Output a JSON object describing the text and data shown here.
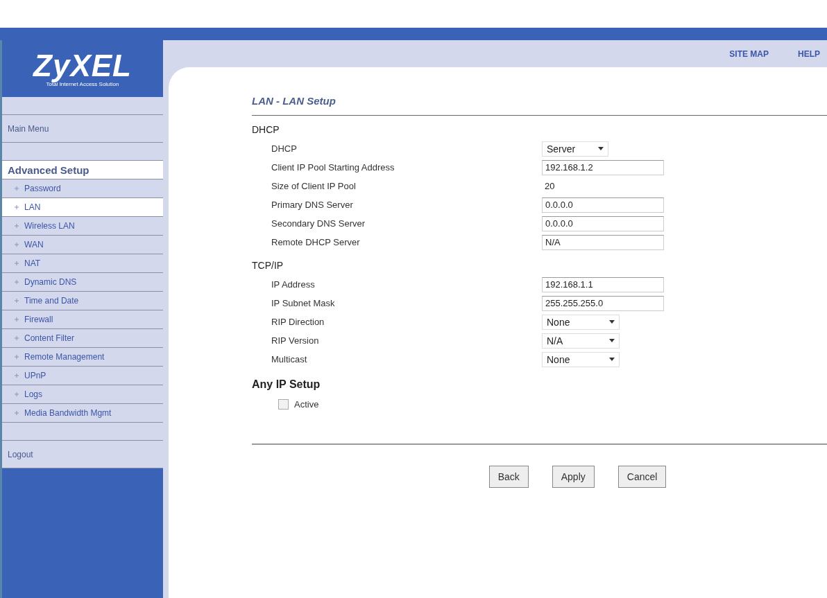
{
  "logo": {
    "brand": "ZyXEL",
    "tagline": "Total Internet Access Solution"
  },
  "header_links": [
    "SITE MAP",
    "HELP"
  ],
  "sidebar": {
    "items": [
      {
        "kind": "spacer"
      },
      {
        "kind": "menu",
        "label": "Main Menu",
        "selected": false
      },
      {
        "kind": "spacer"
      },
      {
        "kind": "section",
        "label": "Advanced Setup"
      },
      {
        "kind": "sub",
        "label": "Password",
        "selected": false
      },
      {
        "kind": "sub",
        "label": "LAN",
        "selected": true
      },
      {
        "kind": "sub",
        "label": "Wireless LAN",
        "selected": false
      },
      {
        "kind": "sub",
        "label": "WAN",
        "selected": false
      },
      {
        "kind": "sub",
        "label": "NAT",
        "selected": false
      },
      {
        "kind": "sub",
        "label": "Dynamic DNS",
        "selected": false
      },
      {
        "kind": "sub",
        "label": "Time and Date",
        "selected": false
      },
      {
        "kind": "sub",
        "label": "Firewall",
        "selected": false
      },
      {
        "kind": "sub",
        "label": "Content Filter",
        "selected": false
      },
      {
        "kind": "sub",
        "label": "Remote Management",
        "selected": false
      },
      {
        "kind": "sub",
        "label": "UPnP",
        "selected": false
      },
      {
        "kind": "sub",
        "label": "Logs",
        "selected": false
      },
      {
        "kind": "sub",
        "label": "Media Bandwidth Mgmt",
        "selected": false
      },
      {
        "kind": "spacer"
      },
      {
        "kind": "menu",
        "label": "Logout",
        "selected": false
      }
    ]
  },
  "page_title": "LAN - LAN Setup",
  "sections": [
    {
      "title": "DHCP",
      "fields": [
        {
          "kind": "select",
          "label": "DHCP",
          "value": "Server"
        },
        {
          "kind": "input",
          "label": "Client IP Pool Starting Address",
          "value": "192.168.1.2"
        },
        {
          "kind": "text",
          "label": "Size of Client IP Pool",
          "value": "20"
        },
        {
          "kind": "input",
          "label": "Primary DNS Server",
          "value": "0.0.0.0"
        },
        {
          "kind": "input",
          "label": "Secondary DNS Server",
          "value": "0.0.0.0"
        },
        {
          "kind": "input",
          "label": "Remote DHCP Server",
          "value": "N/A"
        }
      ]
    },
    {
      "title": "TCP/IP",
      "fields": [
        {
          "kind": "input",
          "label": "IP Address",
          "value": "192.168.1.1"
        },
        {
          "kind": "input",
          "label": "IP Subnet Mask",
          "value": "255.255.255.0"
        },
        {
          "kind": "select",
          "label": "RIP Direction",
          "value": "None"
        },
        {
          "kind": "select",
          "label": "RIP Version",
          "value": "N/A"
        },
        {
          "kind": "select",
          "label": "Multicast",
          "value": "None"
        }
      ]
    },
    {
      "title": "Any IP Setup",
      "fields": [
        {
          "kind": "checkbox",
          "label": "Active",
          "checked": false
        }
      ]
    }
  ],
  "buttons": [
    "Back",
    "Apply",
    "Cancel"
  ]
}
